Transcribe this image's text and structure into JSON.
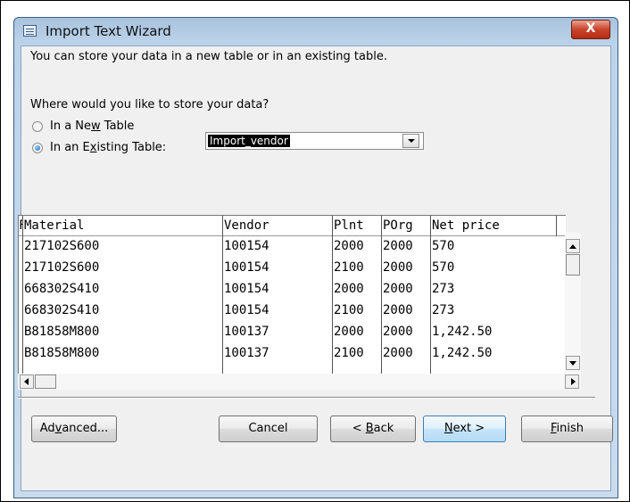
{
  "window": {
    "title": "Import Text Wizard",
    "close_glyph": "X"
  },
  "intro_text": "You can store your data in a new table or in an existing table.",
  "question": "Where would you like to store your data?",
  "options": {
    "new_table": {
      "label": "In a Ne",
      "mnemonic": "w",
      "label_rest": " Table",
      "selected": false
    },
    "existing_table": {
      "label": "In an E",
      "mnemonic": "x",
      "label_rest": "isting Table:",
      "selected": true
    }
  },
  "existing_table_combo": {
    "value": "Import_vendor"
  },
  "preview": {
    "first_col_header": "F",
    "columns": [
      "Material",
      "Vendor",
      "Plnt",
      "POrg",
      "Net price"
    ],
    "rows": [
      [
        "217102S600",
        "100154",
        "2000",
        "2000",
        "570"
      ],
      [
        "217102S600",
        "100154",
        "2100",
        "2000",
        "570"
      ],
      [
        "668302S410",
        "100154",
        "2000",
        "2000",
        "273"
      ],
      [
        "668302S410",
        "100154",
        "2100",
        "2000",
        "273"
      ],
      [
        "B81858M800",
        "100137",
        "2000",
        "2000",
        "1,242.50"
      ],
      [
        "B81858M800",
        "100137",
        "2100",
        "2000",
        "1,242.50"
      ]
    ]
  },
  "buttons": {
    "advanced": {
      "pre": "Ad",
      "mnemonic": "v",
      "post": "anced..."
    },
    "cancel": {
      "label": "Cancel"
    },
    "back": {
      "pre": "< ",
      "mnemonic": "B",
      "post": "ack"
    },
    "next": {
      "pre": "",
      "mnemonic": "N",
      "post": "ext >"
    },
    "finish": {
      "pre": "",
      "mnemonic": "F",
      "post": "inish"
    }
  },
  "colors": {
    "selection_bg": "#000000",
    "close_red": "#c9452c",
    "default_button_border": "#3c7fb1"
  }
}
